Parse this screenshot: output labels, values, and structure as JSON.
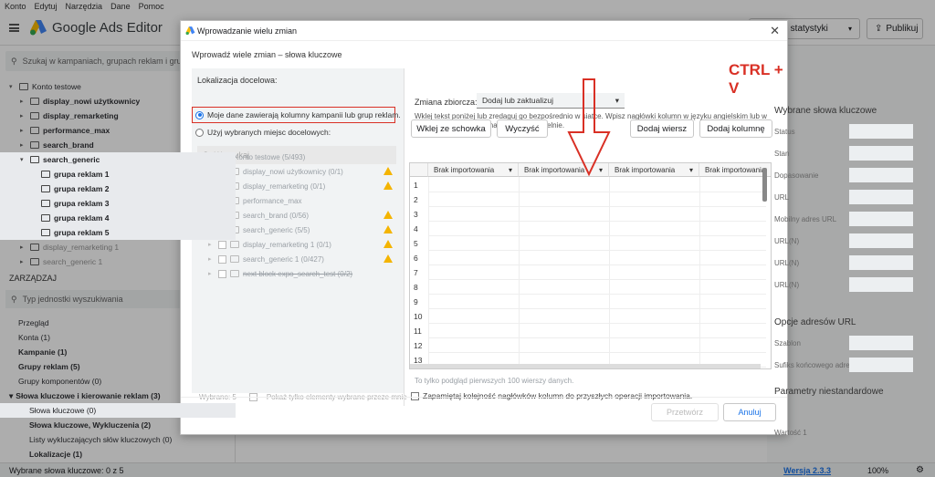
{
  "menu": [
    "Konto",
    "Edytuj",
    "Narzędzia",
    "Dane",
    "Pomoc"
  ],
  "app_title": "Google Ads Editor",
  "top_buttons": {
    "stats": "Pobierz statystyki",
    "publish": "Publikuj"
  },
  "search_placeholder": "Szukaj w kampaniach, grupach reklam i grupac",
  "tree": [
    {
      "label": "Konto testowe",
      "indent": 0,
      "open": true
    },
    {
      "label": "display_nowi użytkownicy",
      "indent": 1,
      "bold": true
    },
    {
      "label": "display_remarketing",
      "indent": 1,
      "bold": true
    },
    {
      "label": "performance_max",
      "indent": 1,
      "bold": true
    },
    {
      "label": "search_brand",
      "indent": 1,
      "bold": true
    },
    {
      "label": "search_generic",
      "indent": 1,
      "bold": true,
      "selected": true,
      "open": true
    },
    {
      "label": "grupa reklam 1",
      "indent": 2,
      "bold": true,
      "selected": true
    },
    {
      "label": "grupa reklam 2",
      "indent": 2,
      "bold": true,
      "selected": true
    },
    {
      "label": "grupa reklam 3",
      "indent": 2,
      "bold": true,
      "selected": true
    },
    {
      "label": "grupa reklam 4",
      "indent": 2,
      "bold": true,
      "selected": true
    },
    {
      "label": "grupa reklam 5",
      "indent": 2,
      "bold": true,
      "selected": true
    },
    {
      "label": "display_remarketing 1",
      "indent": 1
    },
    {
      "label": "search_generic 1",
      "indent": 1
    }
  ],
  "manage": {
    "title": "ZARZĄDZAJ",
    "search_placeholder": "Typ jednostki wyszukiwania",
    "items": [
      {
        "label": "Przegląd"
      },
      {
        "label": "Konta (1)"
      },
      {
        "label": "Kampanie (1)",
        "bold": true
      },
      {
        "label": "Grupy reklam (5)",
        "bold": true
      },
      {
        "label": "Grupy komponentów (0)"
      },
      {
        "label": "Słowa kluczowe i kierowanie reklam (3)",
        "bold": true,
        "section": true
      },
      {
        "label": "Słowa kluczowe (0)",
        "selected": true
      },
      {
        "label": "Słowa kluczowe, Wykluczenia (2)",
        "bold": true
      },
      {
        "label": "Listy wykluczających słów kluczowych (0)"
      },
      {
        "label": "Lokalizacje (1)",
        "bold": true
      }
    ]
  },
  "right_panel": {
    "title": "Wybrane słowa kluczowe",
    "rows": [
      "Status",
      "Stan",
      "Dopasowanie",
      "URL",
      "Mobilny adres URL",
      "URL(N)",
      "URL(N)",
      "URL(N)"
    ],
    "section2": "Opcje adresów URL",
    "rows2": [
      "Szablon",
      "Sufiks końcowego adresu URL"
    ],
    "section3": "Parametry niestandardowe",
    "rows3": [
      "Wartość 1"
    ]
  },
  "status_bar": {
    "selection": "Wybrane słowa kluczowe: 0 z 5",
    "version": "Wersja 2.3.3",
    "zoom": "100%"
  },
  "dialog": {
    "title": "Wprowadzanie wielu zmian",
    "subtitle": "Wprowadź wiele zmian – słowa kluczowe",
    "location_label": "Lokalizacja docelowa:",
    "radio1": "Moje dane zawierają kolumny kampanii lub grup reklam.",
    "radio2": "Użyj wybranych miejsc docelowych:",
    "loc_search": "Wyszukaj",
    "loc_tree": [
      {
        "label": "Konto testowe (5/493)",
        "indent": 0
      },
      {
        "label": "display_nowi użytkownicy (0/1)",
        "indent": 1,
        "warn": true
      },
      {
        "label": "display_remarketing (0/1)",
        "indent": 1,
        "warn": true
      },
      {
        "label": "performance_max",
        "indent": 1
      },
      {
        "label": "search_brand (0/56)",
        "indent": 1,
        "warn": true
      },
      {
        "label": "search_generic (5/5)",
        "indent": 1,
        "warn": true,
        "checked": true
      },
      {
        "label": "display_remarketing 1 (0/1)",
        "indent": 1,
        "warn": true
      },
      {
        "label": "search_generic 1 (0/427)",
        "indent": 1,
        "warn": true
      },
      {
        "label": "next block expo_search_test (0/2)",
        "indent": 1,
        "strike": true
      }
    ],
    "selected_count": "Wybrano: 5",
    "show_selected": "Pokaż tylko elementy wybrane przeze mnie",
    "bulk_label": "Zmiana zbiorcza:",
    "bulk_value": "Dodaj lub zaktualizuj",
    "instructions": "Wklej tekst poniżej lub zredaguj go bezpośrednio w siatce. Wpisz nagłówki kolumn w języku angielskim lub w razie potrzeby wybierz nagłówki samodzielnie.",
    "btn_paste": "Wklej ze schowka",
    "btn_clear": "Wyczyść",
    "btn_add_row": "Dodaj wiersz",
    "btn_add_col": "Dodaj kolumnę",
    "grid_headers": [
      "Brak importowania",
      "Brak importowania",
      "Brak importowania",
      "Brak importowania"
    ],
    "row_numbers": [
      "1",
      "2",
      "3",
      "4",
      "5",
      "6",
      "7",
      "8",
      "9",
      "10",
      "11",
      "12",
      "13"
    ],
    "preview_note": "To tylko podgląd pierwszych 100 wierszy danych.",
    "remember": "Zapamiętaj kolejność nagłówków kolumn do przyszłych operacji importowania.",
    "btn_process": "Przetwórz",
    "btn_cancel": "Anuluj"
  },
  "annotation": "CTRL + V",
  "colors": {
    "accent": "#1a73e8",
    "annotation": "#d93025",
    "warning": "#f4b400"
  }
}
